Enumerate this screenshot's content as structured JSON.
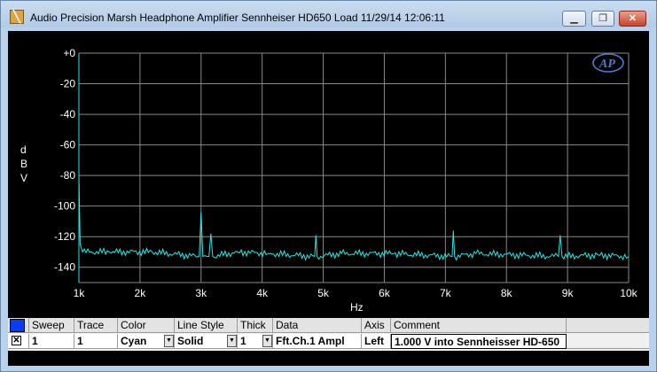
{
  "window": {
    "title": "Audio Precision  Marsh Headphone Amplifier Sennheiser HD650 Load  11/29/14 12:06:11",
    "buttons": {
      "minimize": "▁",
      "restore": "❐",
      "close": "✕"
    }
  },
  "colors": {
    "background": "#000000",
    "grid": "#8a8a8a",
    "axis_text": "#ffffff",
    "trace": "#26e6e6",
    "logo": "#4a7cd6"
  },
  "logo_text": "AP",
  "chart_data": {
    "type": "line",
    "title": "",
    "xlabel": "Hz",
    "ylabel": "dBV",
    "xscale": "linear",
    "xlim": [
      1000,
      10000
    ],
    "ylim": [
      -150,
      0
    ],
    "x_tick_values": [
      1000,
      2000,
      3000,
      4000,
      5000,
      6000,
      7000,
      8000,
      9000,
      10000
    ],
    "x_tick_labels": [
      "1k",
      "2k",
      "3k",
      "4k",
      "5k",
      "6k",
      "7k",
      "8k",
      "9k",
      "10k"
    ],
    "y_tick_values": [
      0,
      -20,
      -40,
      -60,
      -80,
      -100,
      -120,
      -140
    ],
    "y_tick_labels": [
      "+0",
      "-20",
      "-40",
      "-60",
      "-80",
      "-100",
      "-120",
      "-140"
    ],
    "grid": true,
    "series": [
      {
        "name": "Fft.Ch.1 Ampl",
        "noise_floor_dbv": -133,
        "points": [
          {
            "x": 1000,
            "y": -80
          },
          {
            "x": 1020,
            "y": -125
          },
          {
            "x": 1060,
            "y": -130
          },
          {
            "x": 1500,
            "y": -130
          },
          {
            "x": 2200,
            "y": -130
          },
          {
            "x": 2970,
            "y": -133
          },
          {
            "x": 3000,
            "y": -104
          },
          {
            "x": 3030,
            "y": -133
          },
          {
            "x": 3130,
            "y": -133
          },
          {
            "x": 3160,
            "y": -118
          },
          {
            "x": 3190,
            "y": -133
          },
          {
            "x": 3600,
            "y": -130
          },
          {
            "x": 4100,
            "y": -131
          },
          {
            "x": 4860,
            "y": -133
          },
          {
            "x": 4880,
            "y": -119
          },
          {
            "x": 4900,
            "y": -133
          },
          {
            "x": 5300,
            "y": -131
          },
          {
            "x": 6150,
            "y": -131
          },
          {
            "x": 7110,
            "y": -133
          },
          {
            "x": 7130,
            "y": -116
          },
          {
            "x": 7150,
            "y": -133
          },
          {
            "x": 7500,
            "y": -131
          },
          {
            "x": 8850,
            "y": -133
          },
          {
            "x": 8880,
            "y": -119
          },
          {
            "x": 8910,
            "y": -133
          },
          {
            "x": 9500,
            "y": -132
          },
          {
            "x": 10000,
            "y": -133
          }
        ]
      }
    ]
  },
  "legend": {
    "headers": [
      "Sweep",
      "Trace",
      "Color",
      "Line Style",
      "Thick",
      "Data",
      "Axis",
      "Comment"
    ],
    "row": {
      "sweep": "1",
      "trace": "1",
      "color": "Cyan",
      "line_style": "Solid",
      "thick": "1",
      "data": "Fft.Ch.1 Ampl",
      "axis": "Left",
      "comment": "1.000 V into Sennheisser HD-650"
    },
    "dropdown_arrow": "▼",
    "check_mark": "✕"
  }
}
